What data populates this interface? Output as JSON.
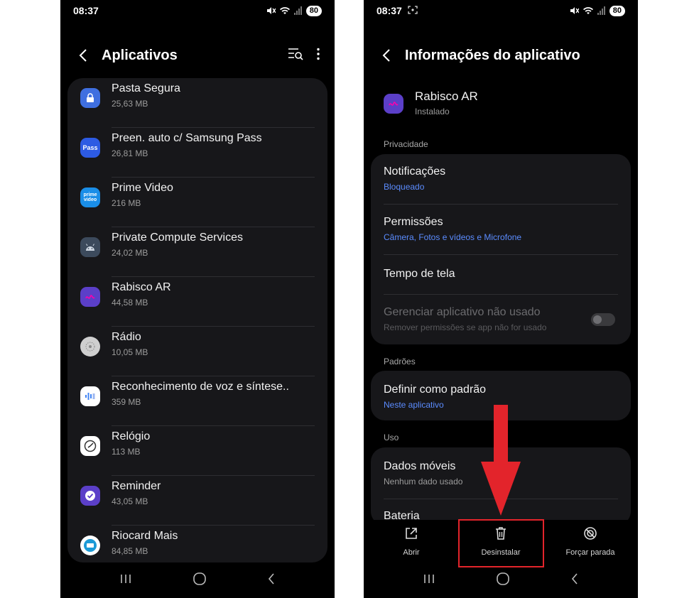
{
  "left": {
    "status": {
      "time": "08:37",
      "battery": "80"
    },
    "title": "Aplicativos",
    "apps": [
      {
        "name": "Pasta Segura",
        "size": "25,63 MB",
        "icon": "lock-folder-icon",
        "color": "#3f6fe0",
        "glyph": ""
      },
      {
        "name": "Preen. auto c/ Samsung Pass",
        "size": "26,81 MB",
        "icon": "samsung-pass-icon",
        "color": "#2d5be3",
        "glyph": "Pass"
      },
      {
        "name": "Prime Video",
        "size": "216 MB",
        "icon": "prime-video-icon",
        "color": "#1a8ee8",
        "glyph": "prime video"
      },
      {
        "name": "Private Compute Services",
        "size": "24,02 MB",
        "icon": "android-icon",
        "color": "#3c4a5c",
        "glyph": ""
      },
      {
        "name": "Rabisco AR",
        "size": "44,58 MB",
        "icon": "rabisco-ar-icon",
        "color": "#5b3fc8",
        "glyph": ""
      },
      {
        "name": "Rádio",
        "size": "10,05 MB",
        "icon": "radio-icon",
        "color": "#cfcfcf",
        "glyph": ""
      },
      {
        "name": "Reconhecimento de voz e síntese..",
        "size": "359 MB",
        "icon": "voice-recognition-icon",
        "color": "#ffffff",
        "glyph": ""
      },
      {
        "name": "Relógio",
        "size": "113 MB",
        "icon": "clock-icon",
        "color": "#ffffff",
        "glyph": ""
      },
      {
        "name": "Reminder",
        "size": "43,05 MB",
        "icon": "reminder-icon",
        "color": "#5b3fc8",
        "glyph": ""
      },
      {
        "name": "Riocard Mais",
        "size": "84,85 MB",
        "icon": "riocard-icon",
        "color": "#ffffff",
        "glyph": ""
      }
    ]
  },
  "right": {
    "status": {
      "time": "08:37",
      "battery": "80"
    },
    "title": "Informações do aplicativo",
    "app": {
      "name": "Rabisco AR",
      "state": "Instalado"
    },
    "sections": {
      "privacy": "Privacidade",
      "defaults": "Padrões",
      "usage": "Uso"
    },
    "privacy_items": {
      "notifications": {
        "label": "Notificações",
        "value": "Bloqueado"
      },
      "permissions": {
        "label": "Permissões",
        "value": "Câmera, Fotos e vídeos e Microfone"
      },
      "screen_time": {
        "label": "Tempo de tela"
      },
      "unused": {
        "label": "Gerenciar aplicativo não usado",
        "value": "Remover permissões se app não for usado",
        "enabled": false
      }
    },
    "defaults_item": {
      "label": "Definir como padrão",
      "value": "Neste aplicativo"
    },
    "usage_items": {
      "mobile_data": {
        "label": "Dados móveis",
        "value": "Nenhum dado usado"
      },
      "battery": {
        "label": "Bateria"
      }
    },
    "actions": {
      "open": "Abrir",
      "uninstall": "Desinstalar",
      "force_stop": "Forçar parada"
    },
    "colors": {
      "accent_link": "#5b8cff",
      "highlight": "#e3242b"
    }
  }
}
